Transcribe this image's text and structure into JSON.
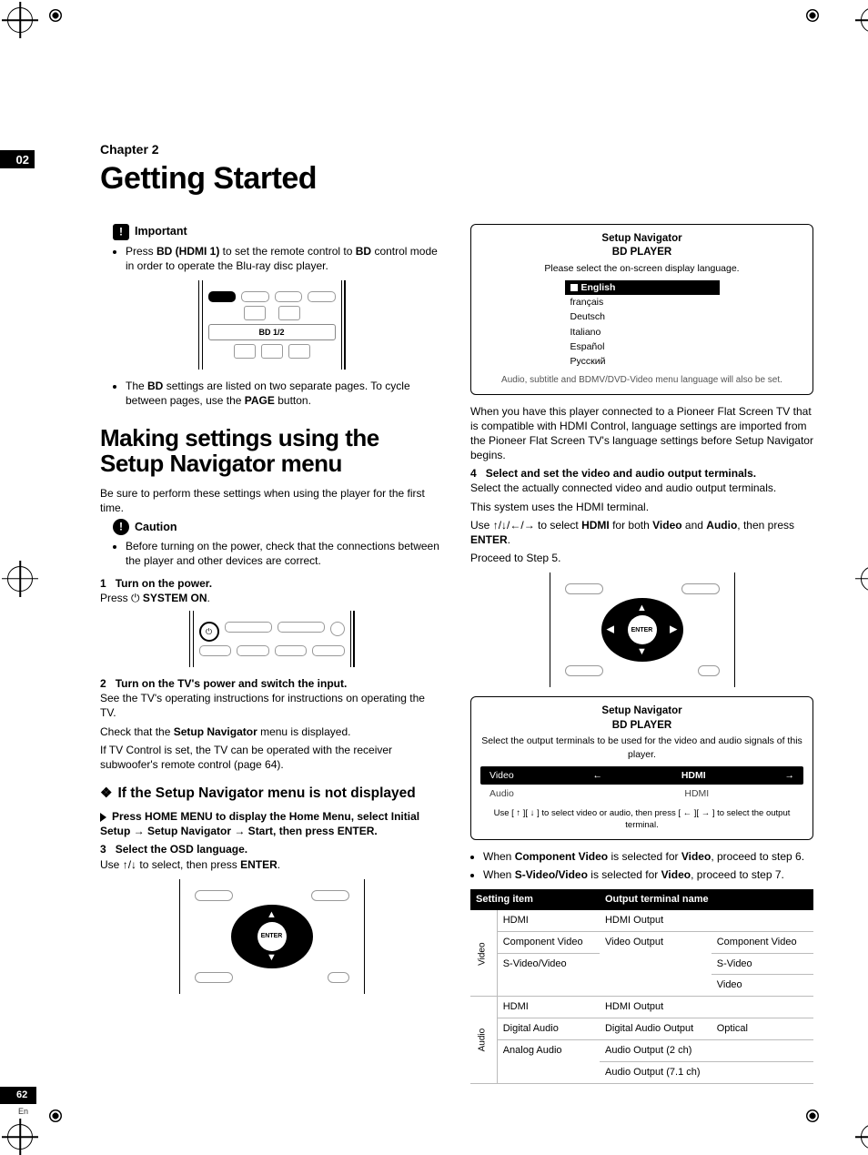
{
  "chapter_tab": "02",
  "chapter_label": "Chapter 2",
  "chapter_title": "Getting Started",
  "page_number": "62",
  "page_lang": "En",
  "important": {
    "label": "Important",
    "b1_pre": "Press ",
    "b1_bold1": "BD (HDMI 1)",
    "b1_mid": " to set the remote control to ",
    "b1_bold2": "BD",
    "b1_post": " control mode in order to operate the Blu-ray disc player.",
    "diagram_label": "BD  1/2",
    "b2_pre": "The ",
    "b2_bold1": "BD",
    "b2_mid": " settings are listed on two separate pages. To cycle between pages, use the ",
    "b2_bold2": "PAGE",
    "b2_post": " button."
  },
  "section1_title": "Making settings using the Setup Navigator menu",
  "section1_intro": "Be sure to perform these settings when using the player for the first time.",
  "caution": {
    "label": "Caution",
    "b1": "Before turning on the power, check that the connections between the player and other devices are correct."
  },
  "step1": {
    "num": "1",
    "title": "Turn on the power.",
    "body_pre": "Press ",
    "body_bold": " SYSTEM ON",
    "body_post": "."
  },
  "step2": {
    "num": "2",
    "title": "Turn on the TV's power and switch the input.",
    "body1": "See the TV's operating instructions for instructions on operating the TV.",
    "body2_pre": "Check that the ",
    "body2_bold": "Setup Navigator",
    "body2_post": " menu is displayed.",
    "body3": "If TV Control is set, the TV can be operated with the receiver subwoofer's remote control (page 64)."
  },
  "subhead1": "If the Setup Navigator menu is not displayed",
  "sub1_tri_line": "Press HOME MENU to display the Home Menu, select Initial Setup → Setup Navigator → Start, then press ENTER.",
  "step3": {
    "num": "3",
    "title": "Select the OSD language.",
    "body_pre": "Use ",
    "body_mid": " to select, then press ",
    "body_bold": "ENTER",
    "body_post": "."
  },
  "nav_center": "ENTER",
  "osd1": {
    "title": "Setup Navigator",
    "sub": "BD PLAYER",
    "instr": "Please select the on-screen display language.",
    "langs": [
      "English",
      "français",
      "Deutsch",
      "Italiano",
      "Español",
      "Русский"
    ],
    "foot": "Audio, subtitle and BDMV/DVD-Video menu language will also be set."
  },
  "right_para1": "When you have this player connected to a Pioneer Flat Screen TV that is compatible with HDMI Control, language settings are imported from the Pioneer Flat Screen TV's language settings before Setup Navigator begins.",
  "step4": {
    "num": "4",
    "title": "Select and set the video and audio output terminals.",
    "l1": "Select the actually connected video and audio output terminals.",
    "l2": "This system uses the HDMI terminal.",
    "l3_pre": "Use ",
    "l3_mid": " to select ",
    "l3_b1": "HDMI",
    "l3_mid2": " for both ",
    "l3_b2": "Video",
    "l3_mid3": " and ",
    "l3_b3": "Audio",
    "l3_mid4": ", then press ",
    "l3_b4": "ENTER",
    "l3_post": ".",
    "l4": "Proceed to Step 5."
  },
  "osd2": {
    "title": "Setup Navigator",
    "sub": "BD PLAYER",
    "instr": "Select the output terminals to be used for the video and audio signals of this player.",
    "row1_left": "Video",
    "row1_right": "HDMI",
    "row2_left": "Audio",
    "row2_right": "HDMI",
    "hint": "Use [  ↑  ][  ↓  ] to select video or audio, then press [  ←  ][  →  ] to select the output terminal."
  },
  "bullets_right": {
    "b1_pre": "When ",
    "b1_bold": "Component Video",
    "b1_mid": " is selected for ",
    "b1_bold2": "Video",
    "b1_post": ", proceed to step 6.",
    "b2_pre": "When ",
    "b2_bold": "S-Video/Video",
    "b2_mid": " is selected for ",
    "b2_bold2": "Video",
    "b2_post": ", proceed to step 7."
  },
  "table": {
    "h1": "Setting item",
    "h2": "Output terminal name",
    "video_cat": "Video",
    "audio_cat": "Audio",
    "rows": [
      {
        "cat": "v",
        "c1": "HDMI",
        "c2": "HDMI Output",
        "c3": ""
      },
      {
        "cat": "v",
        "c1": "Component Video",
        "c2": "Video Output",
        "c3": "Component Video"
      },
      {
        "cat": "v",
        "c1": "S-Video/Video",
        "c2": "",
        "c3": "S-Video"
      },
      {
        "cat": "v",
        "c1": "",
        "c2": "",
        "c3": "Video"
      },
      {
        "cat": "a",
        "c1": "HDMI",
        "c2": "HDMI Output",
        "c3": ""
      },
      {
        "cat": "a",
        "c1": "Digital Audio",
        "c2": "Digital Audio Output",
        "c3": "Optical"
      },
      {
        "cat": "a",
        "c1": "Analog Audio",
        "c2": "Audio Output (2 ch)",
        "c3": ""
      },
      {
        "cat": "a",
        "c1": "",
        "c2": "Audio Output (7.1 ch)",
        "c3": ""
      }
    ]
  }
}
